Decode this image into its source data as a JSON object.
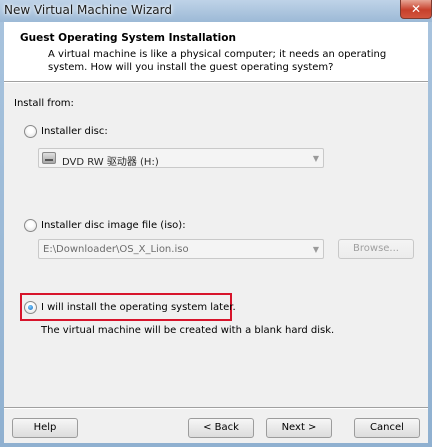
{
  "window": {
    "title": "New Virtual Machine Wizard",
    "close_glyph": "✕"
  },
  "header": {
    "title": "Guest Operating System Installation",
    "description": "A virtual machine is like a physical computer; it needs an operating system. How will you install the guest operating system?"
  },
  "install_from": {
    "label": "Install from:",
    "options": [
      {
        "label": "Installer disc:",
        "selected": false
      },
      {
        "label": "Installer disc image file (iso):",
        "selected": false
      },
      {
        "label": "I will install the operating system later.",
        "selected": true
      }
    ],
    "disc_drive_value": "DVD RW 驱动器 (H:)",
    "iso_path_value": "E:\\Downloader\\OS_X_Lion.iso",
    "browse_label": "Browse...",
    "later_note": "The virtual machine will be created with a blank hard disk."
  },
  "footer": {
    "help_label": "Help",
    "back_label": "< Back",
    "next_label": "Next >",
    "cancel_label": "Cancel"
  },
  "colors": {
    "highlight_border": "#d7142b",
    "title_bar": "#a9c4de"
  },
  "icons": {
    "dropdown": "chevron-down-icon",
    "drive": "dvd-drive-icon"
  }
}
